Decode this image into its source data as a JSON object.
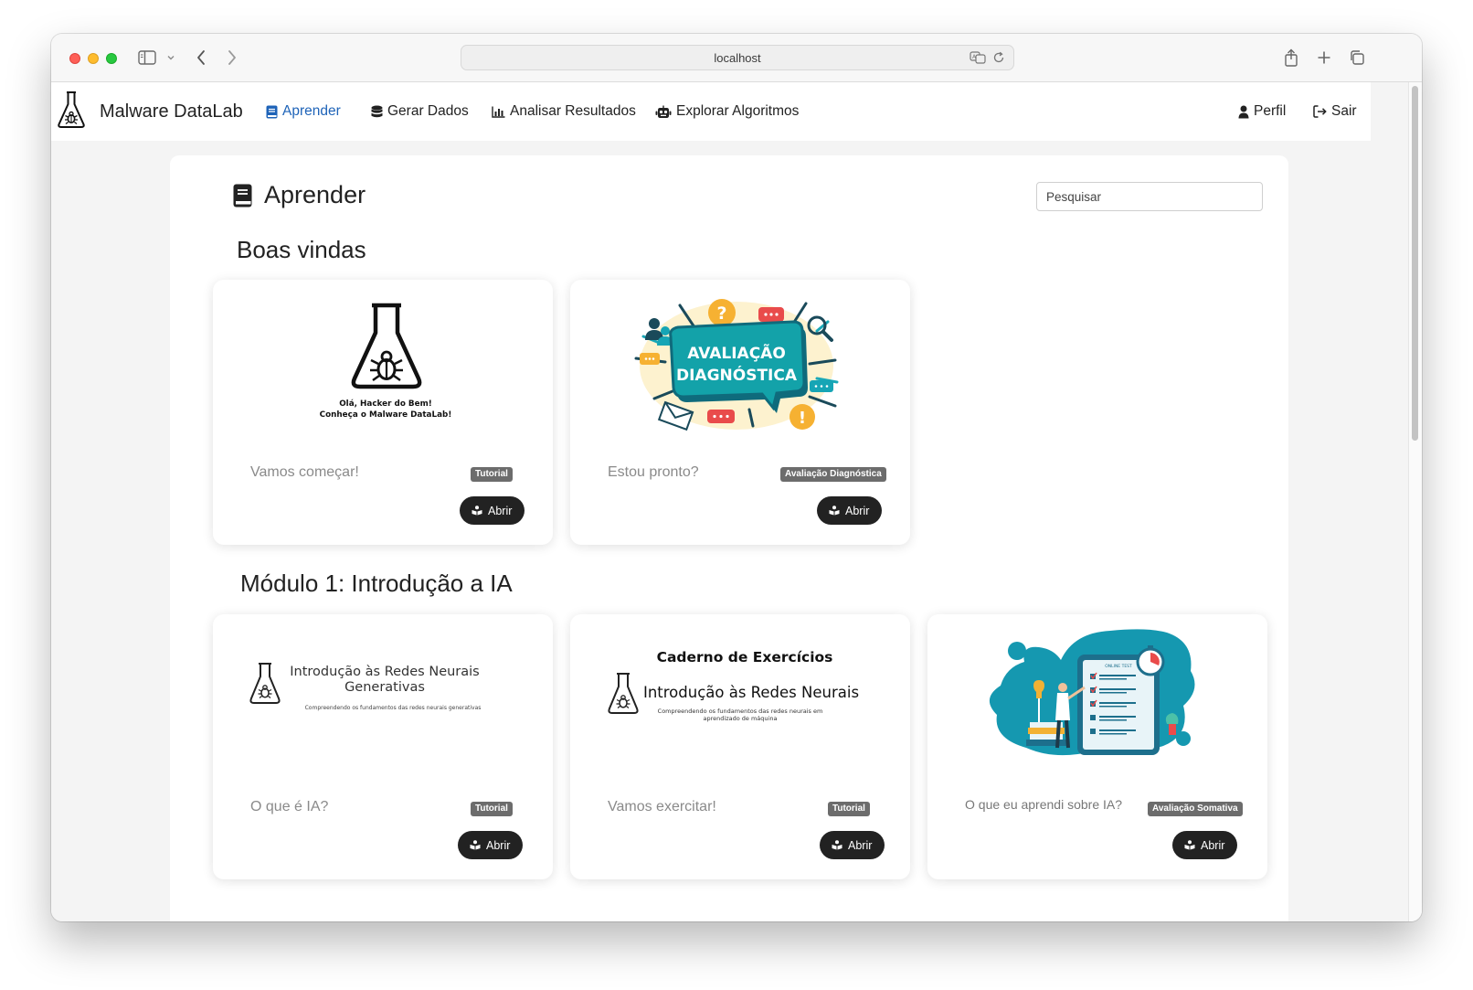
{
  "browser": {
    "url": "localhost"
  },
  "navbar": {
    "brand": "Malware DataLab",
    "items": [
      {
        "label": "Aprender",
        "icon": "book-icon",
        "active": true
      },
      {
        "label": "Gerar Dados",
        "icon": "database-icon"
      },
      {
        "label": "Analisar Resultados",
        "icon": "bar-chart-icon"
      },
      {
        "label": "Explorar Algoritmos",
        "icon": "robot-icon"
      }
    ],
    "right": [
      {
        "label": "Perfil",
        "icon": "user-icon"
      },
      {
        "label": "Sair",
        "icon": "sign-out-icon"
      }
    ]
  },
  "page": {
    "title": "Aprender",
    "search_placeholder": "Pesquisar"
  },
  "sections": [
    {
      "title": "Boas vindas",
      "cards": [
        {
          "caption": "Vamos começar!",
          "badge": "Tutorial",
          "button": "Abrir",
          "image_text": [
            "Olá, Hacker do Bem!",
            "Conheça o Malware DataLab!"
          ]
        },
        {
          "caption": "Estou pronto?",
          "badge": "Avaliação Diagnóstica",
          "button": "Abrir",
          "image_text": [
            "AVALIAÇÃO",
            "DIAGNÓSTICA"
          ]
        }
      ]
    },
    {
      "title": "Módulo 1: Introdução a IA",
      "cards": [
        {
          "caption": "O que é IA?",
          "badge": "Tutorial",
          "button": "Abrir",
          "image_text": [
            "Introdução às Redes Neurais",
            "Generativas",
            "Compreendendo os fundamentos das redes neurais generativas"
          ]
        },
        {
          "caption": "Vamos exercitar!",
          "badge": "Tutorial",
          "button": "Abrir",
          "image_text": [
            "Caderno de Exercícios",
            "Introdução às Redes Neurais",
            "Compreendendo os fundamentos das redes neurais em",
            "aprendizado de máquina"
          ]
        },
        {
          "caption": "O que eu aprendi sobre IA?",
          "badge": "Avaliação Somativa",
          "button": "Abrir",
          "image_text": [
            "ONLINE TEST"
          ]
        }
      ]
    }
  ],
  "colors": {
    "active_nav": "#1e63b8",
    "button_bg": "#222222",
    "badge_bg": "#6c6c6c",
    "teal": "#1598b0",
    "speech_teal": "#0f8a8e"
  }
}
